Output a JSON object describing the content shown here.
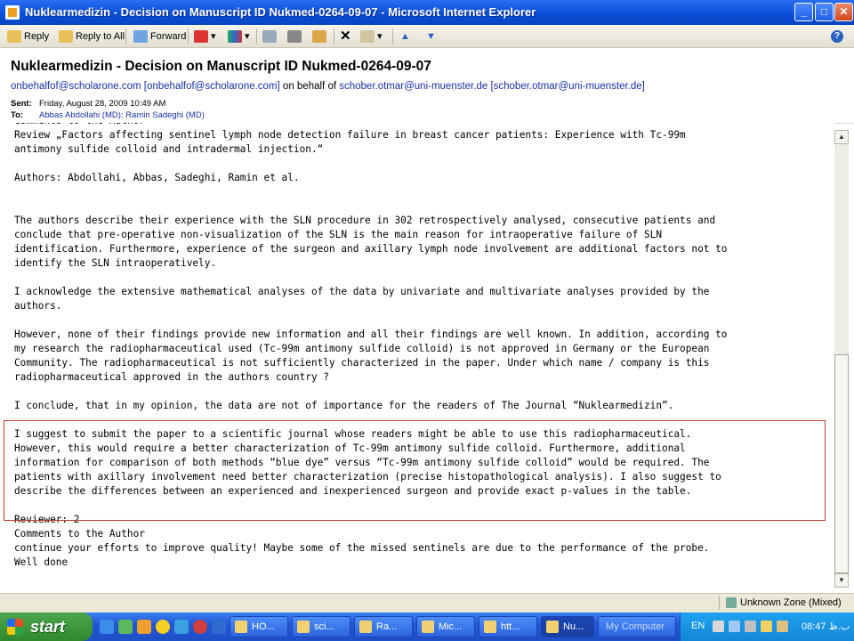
{
  "window": {
    "title": "Nuklearmedizin - Decision on Manuscript ID Nukmed-0264-09-07 - Microsoft Internet Explorer"
  },
  "toolbar": {
    "reply": "Reply",
    "reply_all": "Reply to All",
    "forward": "Forward"
  },
  "email": {
    "subject": "Nuklearmedizin - Decision on Manuscript ID Nukmed-0264-09-07",
    "from_sender": "onbehalfof@scholarone.com [onbehalfof@scholarone.com]",
    "on_behalf_text": " on behalf of ",
    "from_behalf": "schober.otmar@uni-muenster.de [schober.otmar@uni-muenster.de]",
    "sent_label": "Sent:",
    "sent_value": "Friday, August 28, 2009 10:49 AM",
    "to_label": "To:",
    "to_value": "Abbas Abdollahi (MD); Ramin Sadeghi (MD)"
  },
  "body": {
    "lines": [
      "Comments to the Author",
      "Review „Factors affecting sentinel lymph node detection failure in breast cancer patients: Experience with Tc-99m",
      "antimony sulfide colloid and intradermal injection.“",
      "",
      "Authors: Abdollahi, Abbas, Sadeghi, Ramin et al.",
      "",
      "",
      "The authors describe their experience with the SLN procedure in 302 retrospectively analysed, consecutive patients and",
      "conclude that pre-operative non-visualization of the SLN is the main reason for intraoperative failure of SLN",
      "identification. Furthermore, experience of the surgeon and axillary lymph node involvement are additional factors not to",
      "identify the SLN intraoperatively.",
      "",
      "I acknowledge the extensive mathematical analyses of the data by univariate and multivariate analyses provided by the",
      "authors.",
      "",
      "However, none of their findings provide new information and all their findings are well known. In addition, according to",
      "my research the radiopharmaceutical used (Tc-99m antimony sulfide colloid) is not approved in Germany or the European",
      "Community. The radiopharmaceutical is not sufficiently characterized in the paper. Under which name / company is this",
      "radiopharmaceutical approved in the authors country ?",
      "",
      "I conclude, that in my opinion, the data are not of importance for the readers of The Journal “Nuklearmedizin”.",
      "",
      "I suggest to submit the paper to a scientific journal whose readers might be able to use this radiopharmaceutical.",
      "However, this would require a better characterization of Tc-99m antimony sulfide colloid. Furthermore, additional",
      "information for comparison of both methods “blue dye” versus “Tc-99m antimony sulfide colloid” would be required. The",
      "patients with axillary involvement need better characterization (precise histopathological analysis). I also suggest to",
      "describe the differences between an experienced and inexperienced surgeon and provide exact p-values in the table.",
      "",
      "Reviewer: 2",
      "Comments to the Author",
      "continue your efforts to improve quality! Maybe some of the missed sentinels are due to the performance of the probe.",
      "Well done"
    ]
  },
  "status": {
    "zone": "Unknown Zone (Mixed)"
  },
  "taskbar": {
    "start": "start",
    "tasks": [
      "HO...",
      "sci...",
      "Ra...",
      "Mic...",
      "htt...",
      "Nu...",
      "My Computer"
    ],
    "lang": "EN",
    "clock": "08:47 ب.ظ"
  },
  "colors": {
    "title_blue": "#0a4fd6",
    "link_blue": "#1a30a8",
    "highlight_red": "#c0392b",
    "start_green": "#3a9a3a"
  },
  "icons": [
    "reply-icon",
    "reply-all-icon",
    "forward-icon",
    "flag-icon",
    "categories-icon",
    "print-icon",
    "move-icon",
    "delete-icon",
    "up-arrow-icon",
    "down-arrow-icon",
    "help-icon"
  ]
}
